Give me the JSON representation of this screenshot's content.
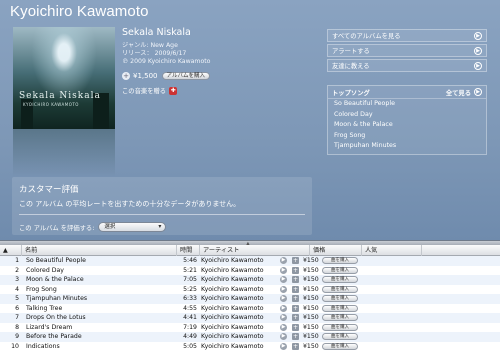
{
  "artist": "Kyoichiro Kawamoto",
  "album": {
    "art_title": "Sekala Niskala",
    "art_subtitle": "KYOICHIRO KAWAMOTO",
    "name": "Sekala Niskala",
    "genre": "ジャンル: New Age",
    "release": "リリース： 2009/6/17",
    "copyright": "℗ 2009 Kyoichiro Kawamoto",
    "price": "¥1,500",
    "buy_label": "アルバムを購入",
    "gift_label": "この音楽を贈る"
  },
  "links": [
    {
      "label": "すべてのアルバムを見る"
    },
    {
      "label": "アラートする"
    },
    {
      "label": "友達に教える"
    }
  ],
  "top_songs": {
    "title": "トップソング",
    "see_all": "全て見る",
    "items": [
      "So Beautiful People",
      "Colored Day",
      "Moon & the Palace",
      "Frog Song",
      "Tjampuhan Minutes"
    ]
  },
  "review": {
    "title": "カスタマー評価",
    "message": "この アルバム の平均レートを出すための十分なデータがありません。",
    "rate_label": "この アルバム を評価する:",
    "rate_select": "選択"
  },
  "table": {
    "headers": {
      "name": "名前",
      "time": "時間",
      "artist": "アーティスト",
      "price": "価格",
      "popularity": "人気"
    },
    "row_buy_label": "曲を購入",
    "rows": [
      {
        "num": "1",
        "name": "So Beautiful People",
        "time": "5:46",
        "artist": "Kyoichiro Kawamoto",
        "price": "¥150"
      },
      {
        "num": "2",
        "name": "Colored Day",
        "time": "5:21",
        "artist": "Kyoichiro Kawamoto",
        "price": "¥150"
      },
      {
        "num": "3",
        "name": "Moon & the Palace",
        "time": "7:05",
        "artist": "Kyoichiro Kawamoto",
        "price": "¥150"
      },
      {
        "num": "4",
        "name": "Frog Song",
        "time": "5:25",
        "artist": "Kyoichiro Kawamoto",
        "price": "¥150"
      },
      {
        "num": "5",
        "name": "Tjampuhan Minutes",
        "time": "6:33",
        "artist": "Kyoichiro Kawamoto",
        "price": "¥150"
      },
      {
        "num": "6",
        "name": "Talking Tree",
        "time": "4:55",
        "artist": "Kyoichiro Kawamoto",
        "price": "¥150"
      },
      {
        "num": "7",
        "name": "Drops On the Lotus",
        "time": "4:41",
        "artist": "Kyoichiro Kawamoto",
        "price": "¥150"
      },
      {
        "num": "8",
        "name": "Lizard's Dream",
        "time": "7:19",
        "artist": "Kyoichiro Kawamoto",
        "price": "¥150"
      },
      {
        "num": "9",
        "name": "Before the Parade",
        "time": "4:49",
        "artist": "Kyoichiro Kawamoto",
        "price": "¥150"
      },
      {
        "num": "10",
        "name": "Indications",
        "time": "5:05",
        "artist": "Kyoichiro Kawamoto",
        "price": "¥150"
      }
    ]
  }
}
